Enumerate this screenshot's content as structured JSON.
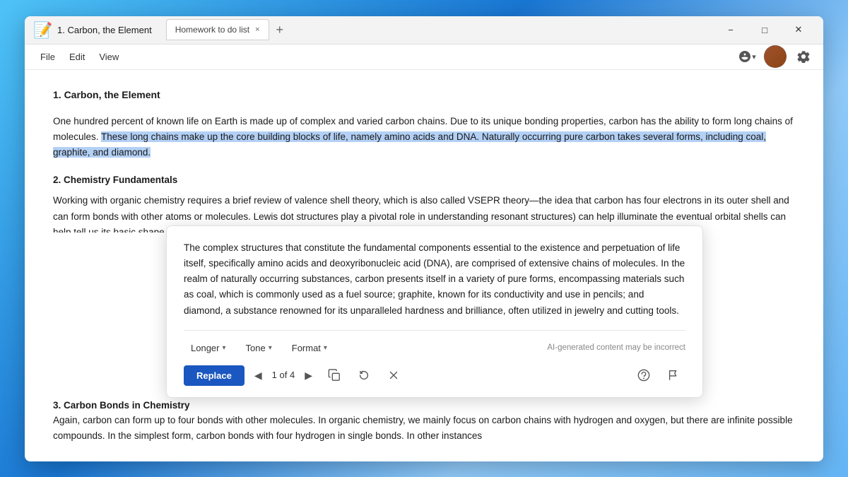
{
  "window": {
    "title": "1. Carbon, the Element",
    "icon": "📝"
  },
  "tab": {
    "label": "Homework to do list",
    "close": "×"
  },
  "menubar": {
    "file": "File",
    "edit": "Edit",
    "view": "View"
  },
  "document": {
    "heading1": "1. Carbon, the Element",
    "paragraph1_pre": "One hundred percent of known life on Earth is made up of complex and varied carbon chains. Due to its unique bonding properties, carbon has the ability to form long chains of molecules. ",
    "paragraph1_highlight": "These long chains make up the core building blocks of life, namely amino acids and DNA. Naturally occurring pure carbon takes several forms, including coal, graphite, and diamond.",
    "heading2": "2. Chemistry Fundamentals",
    "paragraph2": "Working with organic chemistry requires a brief review of valence shell theory, which is also called VSEPR theory—the idea that carbon has four electrons in its outer shell and can form bonds with other atoms or molecules. Lewis dot structures play a pivotal role in understanding resonant structures) can help illuminate the eventual orbital shells can help tell us its basic shape.",
    "heading3": "3. Carbon Bonds in Chemistry",
    "paragraph3": "Again, carbon can form up to four bonds with other molecules. In organic chemistry, we mainly focus on carbon chains with hydrogen and oxygen, but there are infinite possible compounds. In the simplest form, carbon bonds with four hydrogen in single bonds. In other instances"
  },
  "ai_popup": {
    "text": "The complex structures that constitute the fundamental components essential to the existence and perpetuation of life itself, specifically amino acids and deoxyribonucleic acid (DNA), are comprised of extensive chains of molecules. In the realm of naturally occurring substances, carbon presents itself in a variety of pure forms, encompassing materials such as coal, which is commonly used as a fuel source; graphite, known for its conductivity and use in pencils; and diamond, a substance renowned for its unparalleled hardness and brilliance, often utilized in jewelry and cutting tools.",
    "length_label": "Longer",
    "tone_label": "Tone",
    "format_label": "Format",
    "disclaimer": "AI-generated content may be incorrect",
    "replace_label": "Replace",
    "page_counter": "1 of 4",
    "copy_icon": "copy",
    "refresh_icon": "refresh",
    "close_icon": "close",
    "feedback_icon": "feedback",
    "flag_icon": "flag"
  },
  "colors": {
    "accent": "#1a57c0",
    "highlight": "#b3d0f5"
  }
}
